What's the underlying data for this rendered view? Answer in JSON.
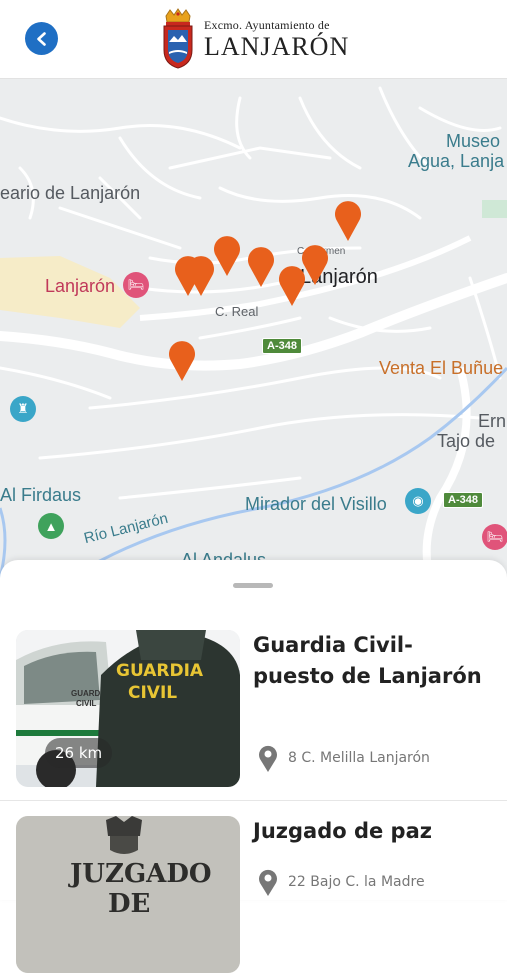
{
  "header": {
    "back_icon": "chevron-left-icon",
    "logo_line1": "Excmo. Ayuntamiento de",
    "logo_line2": "LANJARÓN",
    "accent_color": "#1f6fc4"
  },
  "map": {
    "labels": {
      "museo_line1": "Museo",
      "museo_line2": "Agua, Lanja",
      "balneario": "eario de Lanjarón",
      "lanjaron_hotel": "Lanjarón",
      "town": "Lanjarón",
      "town_prefix": "C",
      "street_real": "C. Real",
      "street_carmen": "C. Carmen",
      "road_a348_1": "A-348",
      "road_a348_2": "A-348",
      "venta": "Venta El Buñue",
      "ern": "Ern",
      "tajo": "Tajo de",
      "al_firdaus": "Al Firdaus",
      "mirador": "Mirador del Visillo",
      "rio": "Río Lanjarón",
      "al_andalus": "Al Andalus"
    },
    "marker_color": "#e8601c",
    "marker_icon": "map-pin-icon"
  },
  "sheet": {
    "cards": [
      {
        "title": "Guardia Civil-puesto de Lanjarón",
        "address": "8 C. Melilla Lanjarón",
        "distance": "26 km",
        "image_text_line1": "GUARDIA",
        "image_text_line2": "CIVIL",
        "image_car_text1": "GUARDIA",
        "image_car_text2": "CIVIL"
      },
      {
        "title": "Juzgado de paz",
        "address": "22 Bajo C. la Madre",
        "image_text_line1": "JUZGADO",
        "image_text_line2": "DE"
      }
    ]
  }
}
